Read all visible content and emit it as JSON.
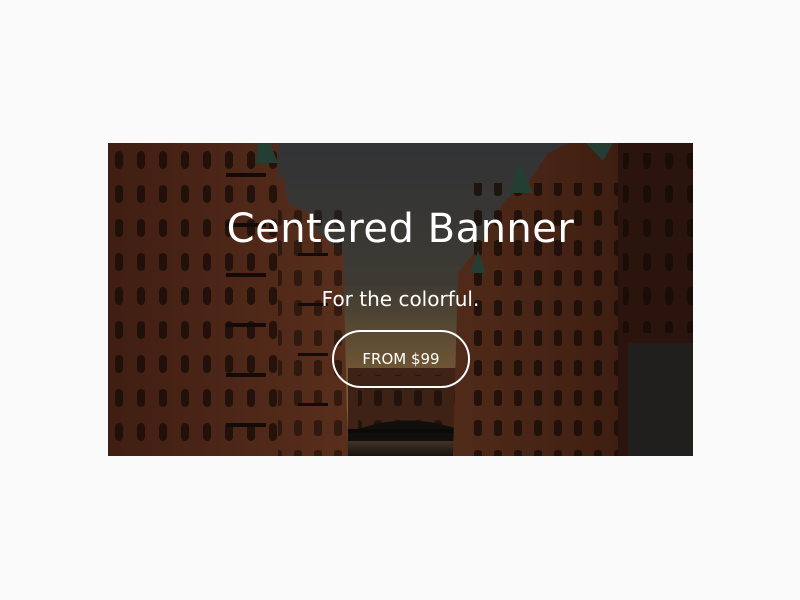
{
  "banner": {
    "title": "Centered Banner",
    "subtitle": "For the colorful.",
    "button_label": "FROM $99",
    "background_image": "city-canal-brick-buildings-at-dusk",
    "overlay_color": "#000000",
    "text_color": "#ffffff"
  },
  "page": {
    "background_color": "#fafafa"
  }
}
